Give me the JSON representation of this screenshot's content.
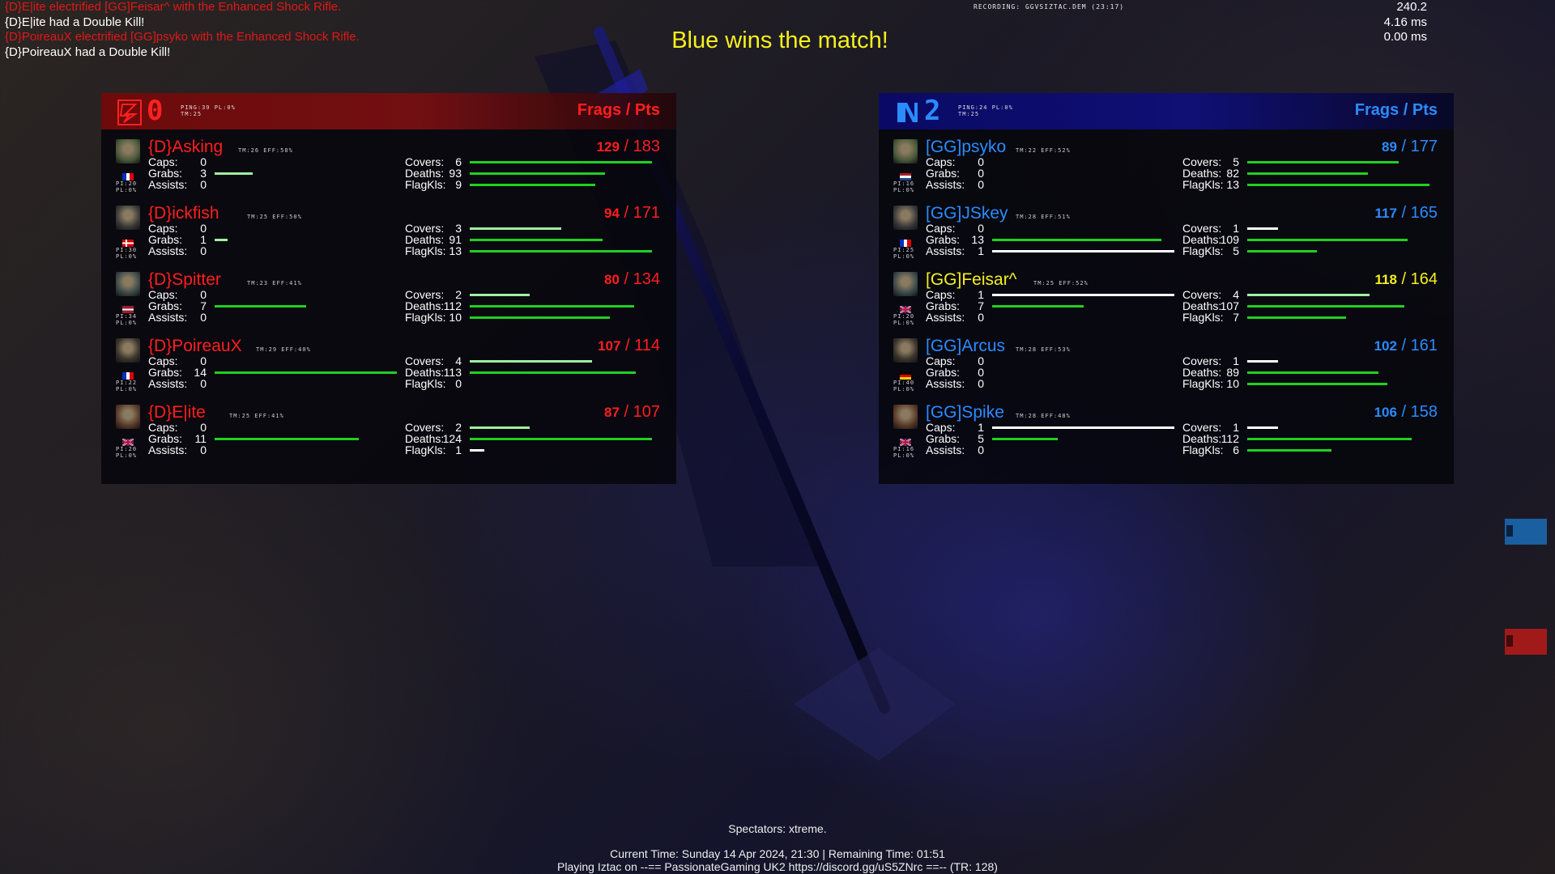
{
  "killfeed": [
    {
      "text": "{D}E|ite electrified [GG]Feisar^ with the Enhanced Shock Rifle.",
      "color": "red"
    },
    {
      "text": "{D}E|ite had a Double Kill!",
      "color": "white"
    },
    {
      "text": "{D}PoireauX electrified [GG]psyko with the Enhanced Shock Rifle.",
      "color": "red"
    },
    {
      "text": "{D}PoireauX had a Double Kill!",
      "color": "white"
    }
  ],
  "recording": "RECORDING: GGVSIZTAC.DEM (23:17)",
  "hud_stats": [
    "240.2",
    "4.16 ms",
    "0.00 ms"
  ],
  "banner": "Blue wins the match!",
  "colors": {
    "red": "#ff1e1e",
    "blue": "#2a8cff",
    "yellow": "#f5f01e",
    "bar_green": "#20d020"
  },
  "red_team": {
    "score": "0",
    "info_line1": "PING:39 PL:0%",
    "info_line2": "TM:25",
    "header": "Frags / Pts",
    "logo": "red-team-logo-icon",
    "players": [
      {
        "name": "{D}Asking",
        "meta": "TM:26 EFF:58%",
        "frags": "129",
        "pts": "183",
        "pi": "PI:20",
        "pl": "PL:0%",
        "flag": "france-flag-icon",
        "caps": "0",
        "grabs": "3",
        "assists": "0",
        "covers": "6",
        "deaths": "93",
        "flagkls": "9",
        "grabs_fill": 0.21,
        "covers_fill": 1.0,
        "deaths_fill": 0.74,
        "flagkls_fill": 0.69,
        "caps_fill": 0,
        "assists_fill": 0
      },
      {
        "name": "{D}ickfish",
        "meta": "TM:25 EFF:50%",
        "frags": "94",
        "pts": "171",
        "pi": "PI:30",
        "pl": "PL:0%",
        "flag": "denmark-flag-icon",
        "caps": "0",
        "grabs": "1",
        "assists": "0",
        "covers": "3",
        "deaths": "91",
        "flagkls": "13",
        "grabs_fill": 0.07,
        "covers_fill": 0.5,
        "deaths_fill": 0.73,
        "flagkls_fill": 1.0,
        "caps_fill": 0,
        "assists_fill": 0
      },
      {
        "name": "{D}Spitter",
        "meta": "TM:23 EFF:41%",
        "frags": "80",
        "pts": "134",
        "pi": "PI:34",
        "pl": "PL:0%",
        "flag": "latvia-flag-icon",
        "caps": "0",
        "grabs": "7",
        "assists": "0",
        "covers": "2",
        "deaths": "112",
        "flagkls": "10",
        "grabs_fill": 0.5,
        "covers_fill": 0.33,
        "deaths_fill": 0.9,
        "flagkls_fill": 0.77,
        "caps_fill": 0,
        "assists_fill": 0
      },
      {
        "name": "{D}PoireauX",
        "meta": "TM:29 EFF:40%",
        "frags": "107",
        "pts": "114",
        "pi": "PI:22",
        "pl": "PL:0%",
        "flag": "france-flag-icon",
        "caps": "0",
        "grabs": "14",
        "assists": "0",
        "covers": "4",
        "deaths": "113",
        "flagkls": "0",
        "grabs_fill": 1.0,
        "covers_fill": 0.67,
        "deaths_fill": 0.91,
        "flagkls_fill": 0,
        "caps_fill": 0,
        "assists_fill": 0
      },
      {
        "name": "{D}E|ite",
        "meta": "TM:25 EFF:41%",
        "frags": "87",
        "pts": "107",
        "pi": "PI:20",
        "pl": "PL:0%",
        "flag": "uk-flag-icon",
        "caps": "0",
        "grabs": "11",
        "assists": "0",
        "covers": "2",
        "deaths": "124",
        "flagkls": "1",
        "grabs_fill": 0.79,
        "covers_fill": 0.33,
        "deaths_fill": 1.0,
        "flagkls_fill": 0.08,
        "caps_fill": 0,
        "assists_fill": 0
      }
    ]
  },
  "blue_team": {
    "score": "2",
    "info_line1": "PING:24 PL:0%",
    "info_line2": "TM:25",
    "header": "Frags / Pts",
    "logo": "blue-team-logo-icon",
    "players": [
      {
        "name": "[GG]psyko",
        "meta": "TM:22 EFF:52%",
        "frags": "89",
        "pts": "177",
        "pi": "PI:16",
        "pl": "PL:0%",
        "flag": "netherlands-flag-icon",
        "caps": "0",
        "grabs": "0",
        "assists": "0",
        "covers": "5",
        "deaths": "82",
        "flagkls": "13",
        "caps_fill": 0,
        "grabs_fill": 0,
        "assists_fill": 0,
        "covers_fill": 0.83,
        "deaths_fill": 0.66,
        "flagkls_fill": 1.0
      },
      {
        "name": "[GG]JSkey",
        "meta": "TM:28 EFF:51%",
        "frags": "117",
        "pts": "165",
        "pi": "PI:25",
        "pl": "PL:0%",
        "flag": "france-flag-icon",
        "caps": "0",
        "grabs": "13",
        "assists": "1",
        "covers": "1",
        "deaths": "109",
        "flagkls": "5",
        "caps_fill": 0,
        "grabs_fill": 0.93,
        "assists_fill": 1.0,
        "covers_fill": 0.17,
        "deaths_fill": 0.88,
        "flagkls_fill": 0.38
      },
      {
        "name": "[GG]Feisar^",
        "meta": "TM:25 EFF:52%",
        "frags": "118",
        "pts": "164",
        "pi": "PI:20",
        "pl": "PL:0%",
        "flag": "uk-flag-icon",
        "highlight": true,
        "caps": "1",
        "grabs": "7",
        "assists": "0",
        "covers": "4",
        "deaths": "107",
        "flagkls": "7",
        "caps_fill": 1.0,
        "grabs_fill": 0.5,
        "assists_fill": 0,
        "covers_fill": 0.67,
        "deaths_fill": 0.86,
        "flagkls_fill": 0.54
      },
      {
        "name": "[GG]Arcus",
        "meta": "TM:28 EFF:53%",
        "frags": "102",
        "pts": "161",
        "pi": "PI:40",
        "pl": "PL:0%",
        "flag": "germany-flag-icon",
        "caps": "0",
        "grabs": "0",
        "assists": "0",
        "covers": "1",
        "deaths": "89",
        "flagkls": "10",
        "caps_fill": 0,
        "grabs_fill": 0,
        "assists_fill": 0,
        "covers_fill": 0.17,
        "deaths_fill": 0.72,
        "flagkls_fill": 0.77
      },
      {
        "name": "[GG]Spike",
        "meta": "TM:28 EFF:48%",
        "frags": "106",
        "pts": "158",
        "pi": "PI:16",
        "pl": "PL:0%",
        "flag": "uk-flag-icon",
        "caps": "1",
        "grabs": "5",
        "assists": "0",
        "covers": "1",
        "deaths": "112",
        "flagkls": "6",
        "caps_fill": 1.0,
        "grabs_fill": 0.36,
        "assists_fill": 0,
        "covers_fill": 0.17,
        "deaths_fill": 0.9,
        "flagkls_fill": 0.46
      }
    ]
  },
  "labels": {
    "caps": "Caps:",
    "grabs": "Grabs:",
    "assists": "Assists:",
    "covers": "Covers:",
    "deaths": "Deaths:",
    "flagkls": "FlagKls:"
  },
  "spectators": "Spectators: xtreme.",
  "footer_line1": "Current Time: Sunday 14 Apr 2024, 21:30 | Remaining Time: 01:51",
  "footer_line2": "Playing Iztac on --== PassionateGaming UK2 https://discord.gg/uS5ZNrc ==-- (TR: 128)"
}
